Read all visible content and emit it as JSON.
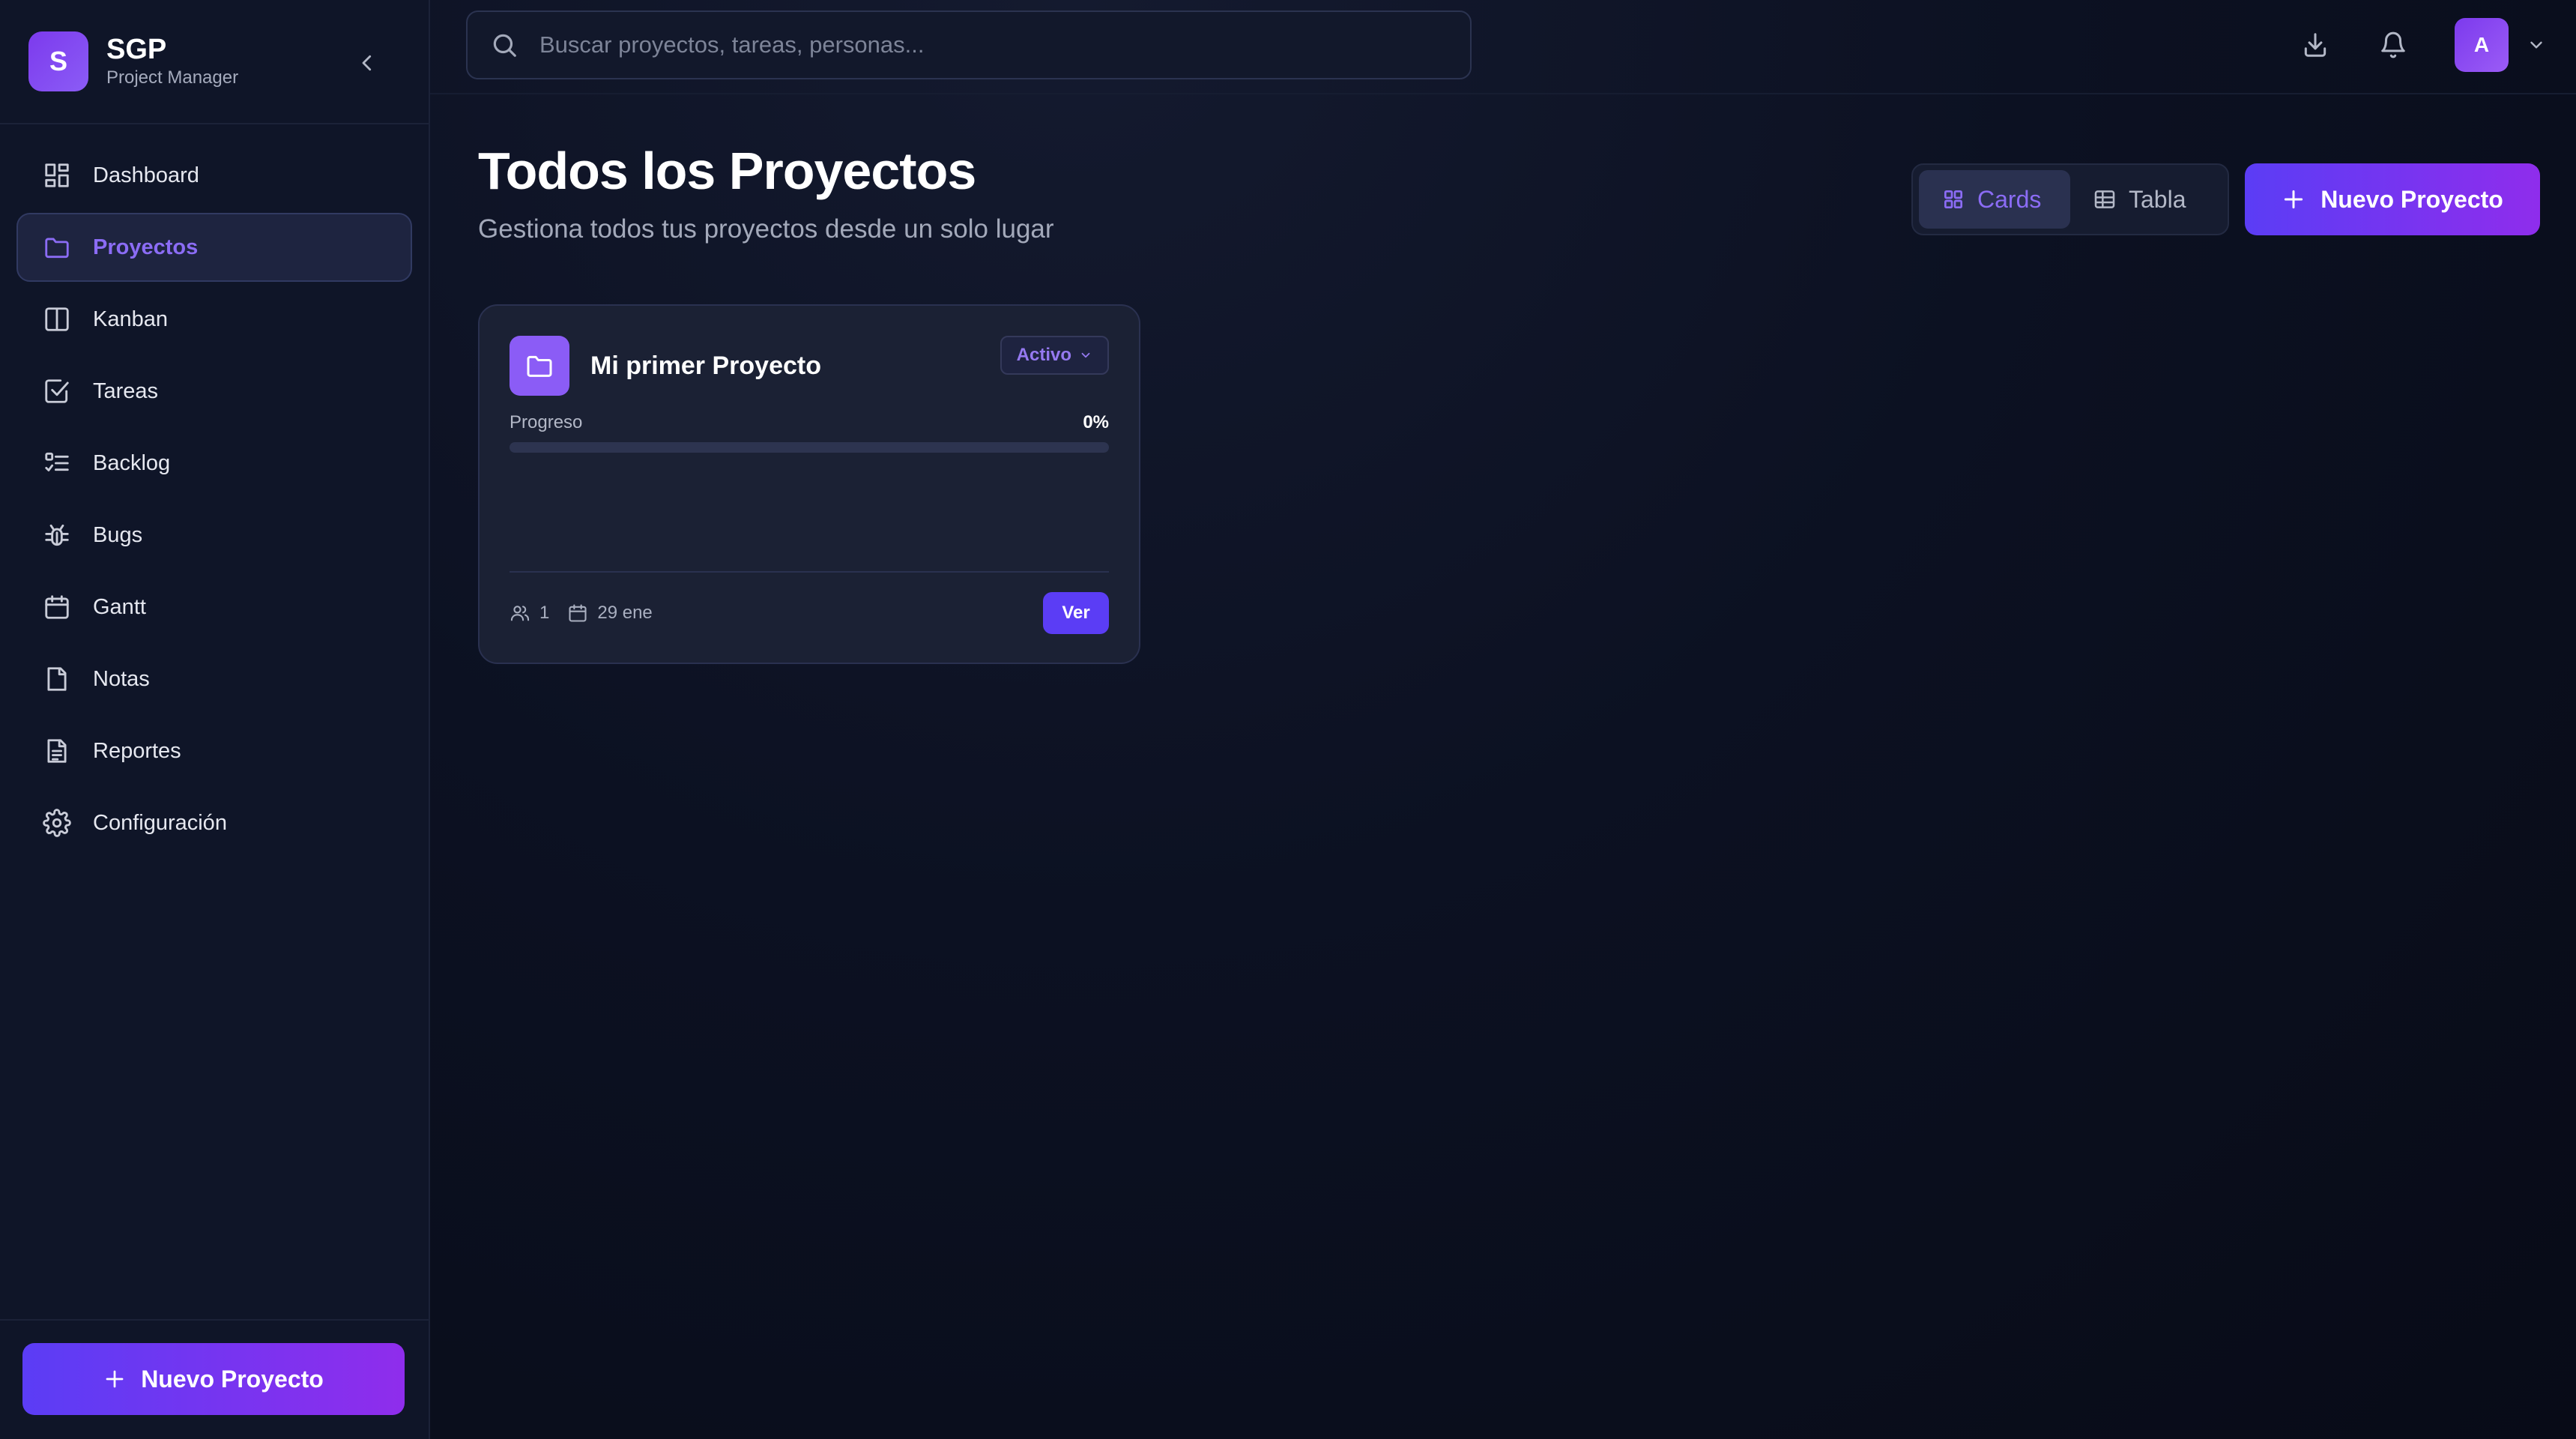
{
  "brand": {
    "logo_letter": "S",
    "name": "SGP",
    "subtitle": "Project Manager"
  },
  "sidebar": {
    "items": [
      {
        "label": "Dashboard",
        "icon": "dashboard-icon"
      },
      {
        "label": "Proyectos",
        "icon": "folder-icon",
        "active": true
      },
      {
        "label": "Kanban",
        "icon": "kanban-icon"
      },
      {
        "label": "Tareas",
        "icon": "checkbox-icon"
      },
      {
        "label": "Backlog",
        "icon": "list-check-icon"
      },
      {
        "label": "Bugs",
        "icon": "bug-icon"
      },
      {
        "label": "Gantt",
        "icon": "calendar-icon"
      },
      {
        "label": "Notas",
        "icon": "note-icon"
      },
      {
        "label": "Reportes",
        "icon": "report-icon"
      },
      {
        "label": "Configuración",
        "icon": "gear-icon"
      }
    ],
    "new_project_label": "Nuevo Proyecto"
  },
  "topbar": {
    "search_placeholder": "Buscar proyectos, tareas, personas...",
    "avatar_letter": "A"
  },
  "page": {
    "title": "Todos los Proyectos",
    "subtitle": "Gestiona todos tus proyectos desde un solo lugar",
    "view_options": [
      {
        "label": "Cards",
        "active": true
      },
      {
        "label": "Tabla",
        "active": false
      }
    ],
    "new_project_label": "Nuevo Proyecto"
  },
  "projects": [
    {
      "name": "Mi primer Proyecto",
      "status": "Activo",
      "progress_label": "Progreso",
      "progress_text": "0%",
      "progress": 0,
      "members": "1",
      "date": "29 ene",
      "action_label": "Ver"
    }
  ],
  "colors": {
    "accent": "#8b5cf6",
    "primary": "#5b3df5",
    "background": "#0a0e1c",
    "sidebar": "#0f1528"
  }
}
